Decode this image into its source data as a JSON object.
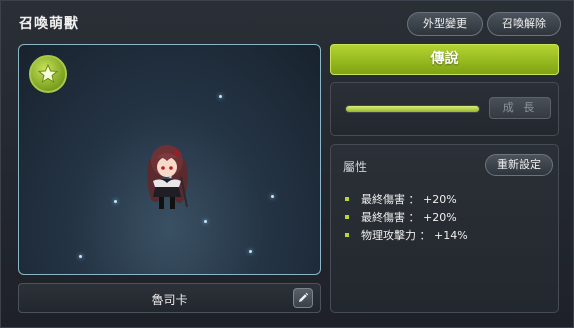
{
  "window": {
    "title": "召喚萌獸",
    "appearance_button": "外型變更",
    "unsummon_button": "召喚解除"
  },
  "pet": {
    "name": "魯司卡",
    "rank_button": "傳說",
    "growth_button": "成 長",
    "growth_progress_percent": 100
  },
  "attributes": {
    "title": "屬性",
    "reset_button": "重新設定",
    "items": [
      "最終傷害 ： +20%",
      "最終傷害 ： +20%",
      "物理攻擊力 ： +14%"
    ]
  },
  "colors": {
    "accent_green": "#9cc022",
    "frame_blue": "#8ab6c8"
  },
  "icons": [
    "star-icon",
    "pencil-icon"
  ]
}
